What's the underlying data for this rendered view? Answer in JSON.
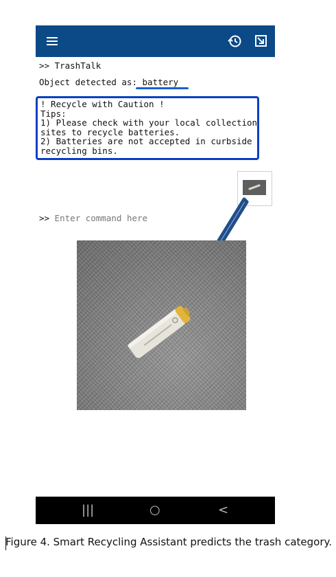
{
  "app": {
    "menu_icon": "hamburger-menu-icon",
    "history_icon": "history-icon",
    "expand_icon": "open-external-icon"
  },
  "terminal": {
    "header_line": ">> TrashTalk",
    "detected_line": "Object detected as: battery"
  },
  "tips_box": {
    "text": "! Recycle with Caution !\nTips:\n1) Please check with your local collection\nsites to recycle batteries.\n2) Batteries are not accepted in curbside\nrecycling bins."
  },
  "command": {
    "prompt": ">>",
    "placeholder": "Enter command here"
  },
  "navbar": {
    "recents": "|||",
    "home": "○",
    "back": "<"
  },
  "caption": "Figure 4. Smart Recycling Assistant predicts the trash category.",
  "colors": {
    "appbar": "#0b4a86",
    "tips_border": "#0a3fc4",
    "arrow": "#1f4e8c"
  }
}
